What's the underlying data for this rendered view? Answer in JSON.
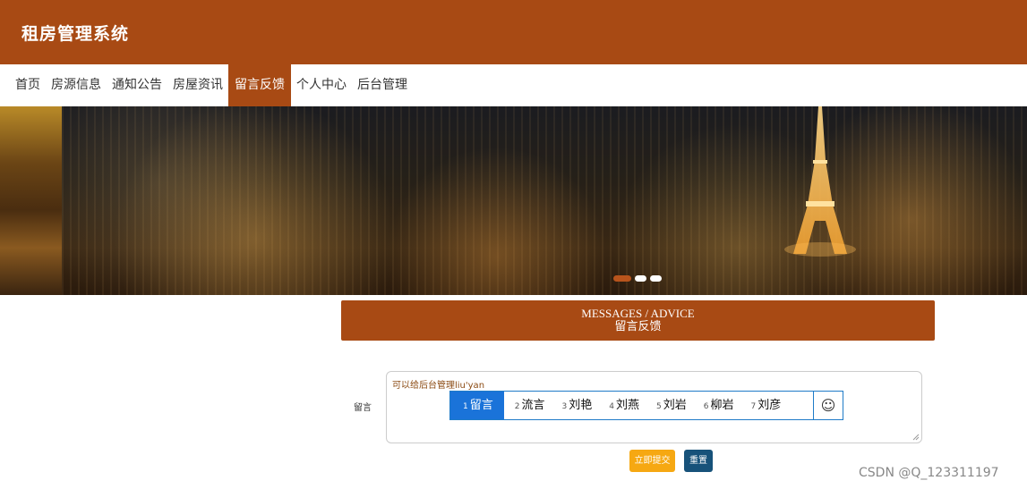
{
  "header": {
    "title": "租房管理系统",
    "background": "#a84a14"
  },
  "nav": {
    "items": [
      {
        "label": "首页",
        "active": false
      },
      {
        "label": "房源信息",
        "active": false
      },
      {
        "label": "通知公告",
        "active": false
      },
      {
        "label": "房屋资讯",
        "active": false
      },
      {
        "label": "留言反馈",
        "active": true
      },
      {
        "label": "个人中心",
        "active": false
      },
      {
        "label": "后台管理",
        "active": false
      }
    ]
  },
  "banner": {
    "slides": 3,
    "active_slide": 1
  },
  "section": {
    "title_en": "MESSAGES / ADVICE",
    "title_cn": "留言反馈"
  },
  "form": {
    "message_label": "留言",
    "message_value": "可以给后台管理liu'yan",
    "submit_label": "立即提交",
    "reset_label": "重置"
  },
  "ime": {
    "candidates": [
      {
        "num": "1",
        "text": "留言"
      },
      {
        "num": "2",
        "text": "流言"
      },
      {
        "num": "3",
        "text": "刘艳"
      },
      {
        "num": "4",
        "text": "刘燕"
      },
      {
        "num": "5",
        "text": "刘岩"
      },
      {
        "num": "6",
        "text": "柳岩"
      },
      {
        "num": "7",
        "text": "刘彦"
      }
    ],
    "selected_index": 0,
    "emoji_icon": "☺"
  },
  "watermark": "CSDN @Q_123311197",
  "colors": {
    "accent": "#a84a14",
    "submit": "#f6a812",
    "reset": "#17527a",
    "ime_selected": "#1a73d9"
  }
}
